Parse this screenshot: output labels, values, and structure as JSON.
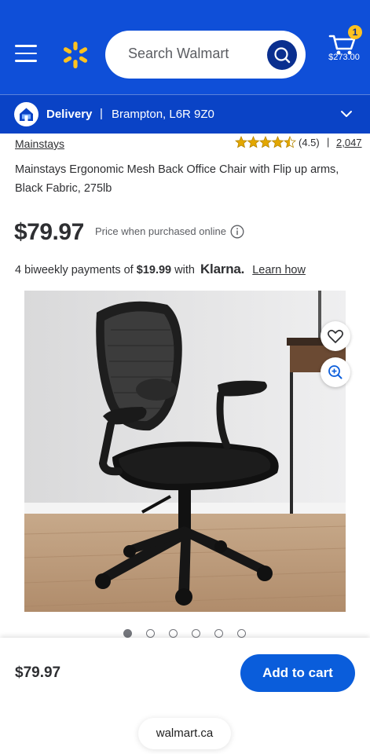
{
  "header": {
    "search_placeholder": "Search Walmart",
    "cart_count": "1",
    "cart_total": "$273.00",
    "brand_color": "#0f4fd8",
    "spark_color": "#ffc220"
  },
  "delivery": {
    "label": "Delivery",
    "separator": "|",
    "location": "Brampton, L6R 9Z0"
  },
  "product": {
    "brand": "Mainstays",
    "rating": "(4.5)",
    "rating_separator": "|",
    "review_count": "2,047",
    "title": "Mainstays Ergonomic Mesh Back Office Chair with Flip up arms, Black Fabric, 275lb",
    "price": "$79.97",
    "price_note": "Price when purchased online",
    "klarna": {
      "prefix": "4 biweekly payments of",
      "amount": "$19.99",
      "with": "with",
      "logo": "Klarna.",
      "link": "Learn how"
    },
    "image_alt": "Mainstays Ergonomic Mesh Back Office Chair",
    "carousel_count": 6,
    "carousel_active": 0
  },
  "bottom_bar": {
    "price": "$79.97",
    "add_to_cart": "Add to cart",
    "url": "walmart.ca"
  }
}
